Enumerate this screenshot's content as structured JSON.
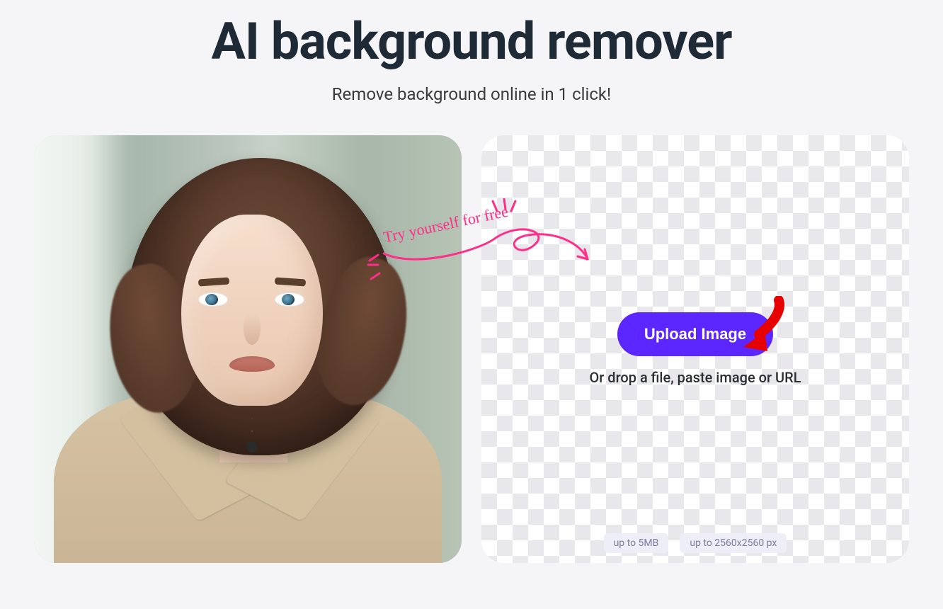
{
  "header": {
    "title": "AI background remover",
    "subtitle": "Remove background online in 1 click!"
  },
  "callout": {
    "text": "Try yourself for free"
  },
  "upload": {
    "button_label": "Upload Image",
    "drop_text": "Or drop a file, paste image or URL"
  },
  "limits": {
    "size": "up to 5MB",
    "dimensions": "up to 2560x2560 px"
  },
  "colors": {
    "accent": "#5b26ff",
    "callout": "#ff2e88",
    "pointer": "#e60000"
  }
}
